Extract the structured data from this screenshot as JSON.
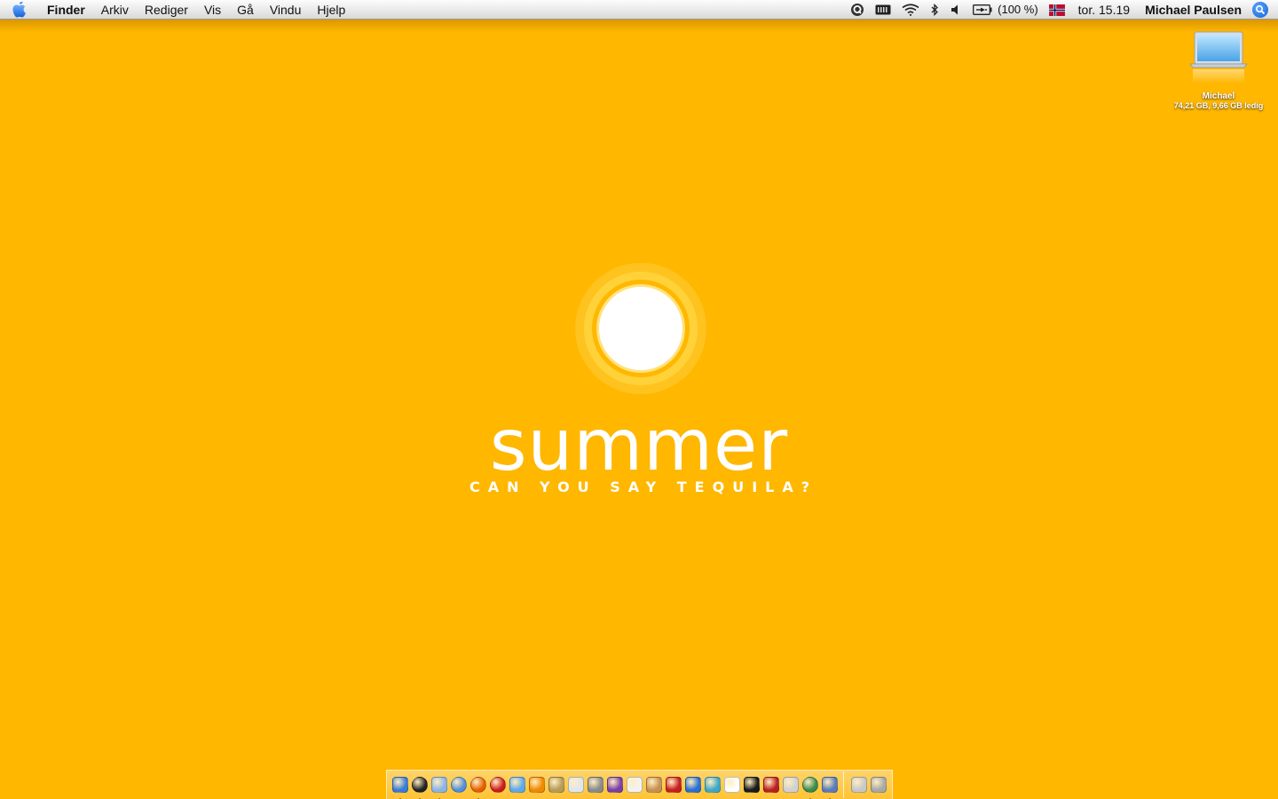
{
  "menubar": {
    "app_name": "Finder",
    "menus": [
      "Arkiv",
      "Rediger",
      "Vis",
      "Gå",
      "Vindu",
      "Hjelp"
    ],
    "battery_text": "(100 %)",
    "clock": "tor. 15.19",
    "user": "Michael Paulsen",
    "status_icons": [
      "quicksilver-icon",
      "ram-meter-icon",
      "wifi-icon",
      "bluetooth-icon",
      "volume-icon",
      "battery-icon",
      "norwegian-flag-icon",
      "spotlight-icon"
    ]
  },
  "desktop": {
    "hd_icon": {
      "title": "Michael",
      "info": "74,21 GB, 9,66 GB ledig"
    }
  },
  "wallpaper": {
    "title": "summer",
    "subtitle": "CAN YOU SAY TEQUILA?",
    "background_color": "#FFB700"
  },
  "dock": {
    "apps": [
      {
        "icon": "finder-icon",
        "color": "#3a7bd5",
        "running": true
      },
      {
        "icon": "dashboard-icon",
        "color": "#222222",
        "running": true
      },
      {
        "icon": "mail-icon",
        "color": "#8ab4e8",
        "running": true
      },
      {
        "icon": "safari-icon",
        "color": "#4f8fd8",
        "running": false
      },
      {
        "icon": "firefox-icon",
        "color": "#e66000",
        "running": true
      },
      {
        "icon": "opera-icon",
        "color": "#cc1b1b",
        "running": false
      },
      {
        "icon": "itunes-icon",
        "color": "#5fa8e8",
        "running": false
      },
      {
        "icon": "vlc-icon",
        "color": "#f08a00",
        "running": false
      },
      {
        "icon": "script-editor-icon",
        "color": "#b89a5a",
        "running": false
      },
      {
        "icon": "textedit-icon",
        "color": "#dfe6ee",
        "running": false
      },
      {
        "icon": "utility-icon",
        "color": "#8a8a8a",
        "running": false
      },
      {
        "icon": "purple-app-icon",
        "color": "#7a3ea8",
        "running": false
      },
      {
        "icon": "pages-icon",
        "color": "#f2f2f2",
        "running": false
      },
      {
        "icon": "transmit-icon",
        "color": "#c89050",
        "running": false
      },
      {
        "icon": "red-app-icon",
        "color": "#c81e1e",
        "running": false
      },
      {
        "icon": "word-icon",
        "color": "#2a6fd0",
        "running": false
      },
      {
        "icon": "airport-icon",
        "color": "#3fa8c8",
        "running": false
      },
      {
        "icon": "ical-icon",
        "color": "#ffffff",
        "running": false
      },
      {
        "icon": "terminal-icon",
        "color": "#1a1a1a",
        "running": false
      },
      {
        "icon": "photo-app-icon",
        "color": "#b82020",
        "running": false
      },
      {
        "icon": "system-preferences-icon",
        "color": "#d0d0d0",
        "running": false
      },
      {
        "icon": "network-app-icon",
        "color": "#3a8a4a",
        "running": true
      },
      {
        "icon": "adium-icon",
        "color": "#5a7ab8",
        "running": true
      }
    ],
    "trailing": [
      {
        "icon": "downloads-stack-icon",
        "color": "#c8c8c8"
      },
      {
        "icon": "trash-icon",
        "color": "#a8a8a8"
      }
    ]
  }
}
